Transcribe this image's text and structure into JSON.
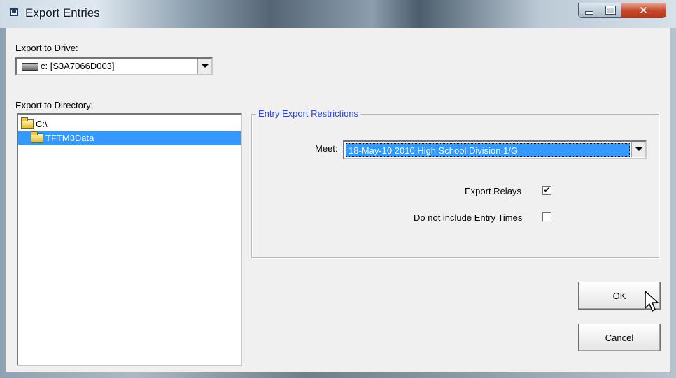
{
  "window": {
    "title": "Export Entries"
  },
  "drive": {
    "label": "Export to Drive:",
    "value": "c: [S3A7066D003]"
  },
  "directory": {
    "label": "Export to Directory:",
    "items": [
      {
        "name": "C:\\",
        "selected": false
      },
      {
        "name": "TFTM3Data",
        "selected": true
      }
    ]
  },
  "restrictions": {
    "title": "Entry Export Restrictions",
    "meet_label": "Meet:",
    "meet_value": "18-May-10 2010 High School Division 1/G",
    "export_relays_label": "Export Relays",
    "export_relays_checked": true,
    "no_entry_times_label": "Do not include Entry Times",
    "no_entry_times_checked": false,
    "check_mark": "✔"
  },
  "buttons": {
    "ok": "OK",
    "cancel": "Cancel"
  },
  "icons": {
    "drive": "hard-drive-icon",
    "folder": "folder-icon",
    "window": "app-icon"
  },
  "colors": {
    "selection": "#3399ff",
    "group_title": "#2c45d6"
  }
}
